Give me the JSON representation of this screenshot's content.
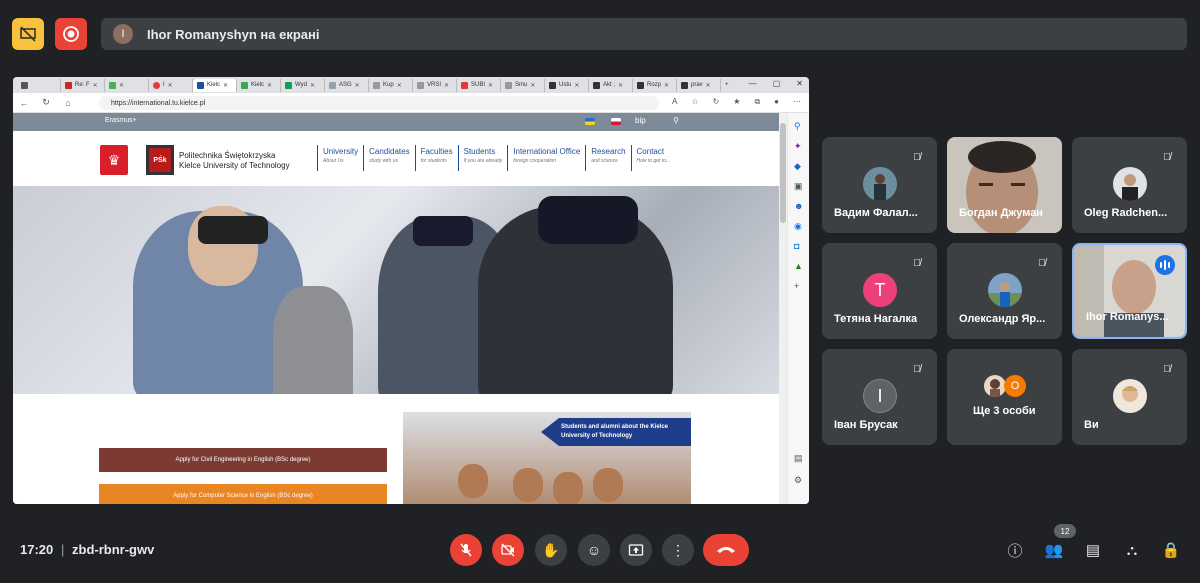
{
  "topbar": {
    "presenting_avatar_letter": "I",
    "presenting_text": "Ihor Romanyshyn на екрані"
  },
  "browser": {
    "tabs": [
      {
        "label": "Re: F"
      },
      {
        "label": ""
      },
      {
        "label": "I"
      },
      {
        "label": "Kielc"
      },
      {
        "label": "Kielc"
      },
      {
        "label": "Wyd"
      },
      {
        "label": "ASG"
      },
      {
        "label": "Kup"
      },
      {
        "label": "VRSI"
      },
      {
        "label": "SUBI"
      },
      {
        "label": "Smu"
      },
      {
        "label": "Ustu"
      },
      {
        "label": "Akt ;"
      },
      {
        "label": "Rozp"
      },
      {
        "label": "prav"
      }
    ],
    "url": "https://international.tu.kielce.pl"
  },
  "site": {
    "erasmus_label": "Erasmus+",
    "bip_label": "bip",
    "uni_name_pl": "Politechnika Świętokrzyska",
    "uni_name_en": "Kielce University of Technology",
    "psk_logo": "PŚk",
    "menu": [
      {
        "title": "University",
        "sub": "About Us"
      },
      {
        "title": "Candidates",
        "sub": "study with us"
      },
      {
        "title": "Faculties",
        "sub": "for students"
      },
      {
        "title": "Students",
        "sub": "If you are already"
      },
      {
        "title": "International Office",
        "sub": "foreign cooperation"
      },
      {
        "title": "Research",
        "sub": "and science"
      },
      {
        "title": "Contact",
        "sub": "How to get to..."
      }
    ],
    "btn_civil": "Apply for Civil Engineering in English (BSc degree)",
    "btn_cs": "Apply for Computer Science in English (BSc degree)",
    "alumni_banner": "Students and alumni about the Kielce University of Technology"
  },
  "participants": [
    {
      "name": "Вадим Фалал...",
      "type": "avatar-photo",
      "muted": true
    },
    {
      "name": "Богдан Джуман",
      "type": "video",
      "muted": false
    },
    {
      "name": "Oleg Radchen...",
      "type": "avatar-photo",
      "muted": true
    },
    {
      "name": "Тетяна Нагалка",
      "type": "letter",
      "letter": "T",
      "color": "#ec407a",
      "muted": true
    },
    {
      "name": "Олександр Яр...",
      "type": "avatar-photo",
      "muted": true
    },
    {
      "name": "Ihor Romanys...",
      "type": "video",
      "speaking": true
    },
    {
      "name": "Іван Брусак",
      "type": "letter",
      "letter": "І",
      "color": "#5f6368",
      "muted": true
    },
    {
      "name": "Ще 3 особи",
      "type": "group",
      "letter": "O",
      "color": "#f57c00"
    },
    {
      "name": "Ви",
      "type": "avatar-photo",
      "muted": true
    }
  ],
  "bottombar": {
    "time": "17:20",
    "separator": "|",
    "meeting_code": "zbd-rbnr-gwv",
    "participant_count": "12"
  },
  "colors": {
    "background": "#202124",
    "tile": "#3c4043",
    "red": "#ea4335",
    "yellow": "#f9c23c",
    "active_speaker": "#1a73e8"
  }
}
